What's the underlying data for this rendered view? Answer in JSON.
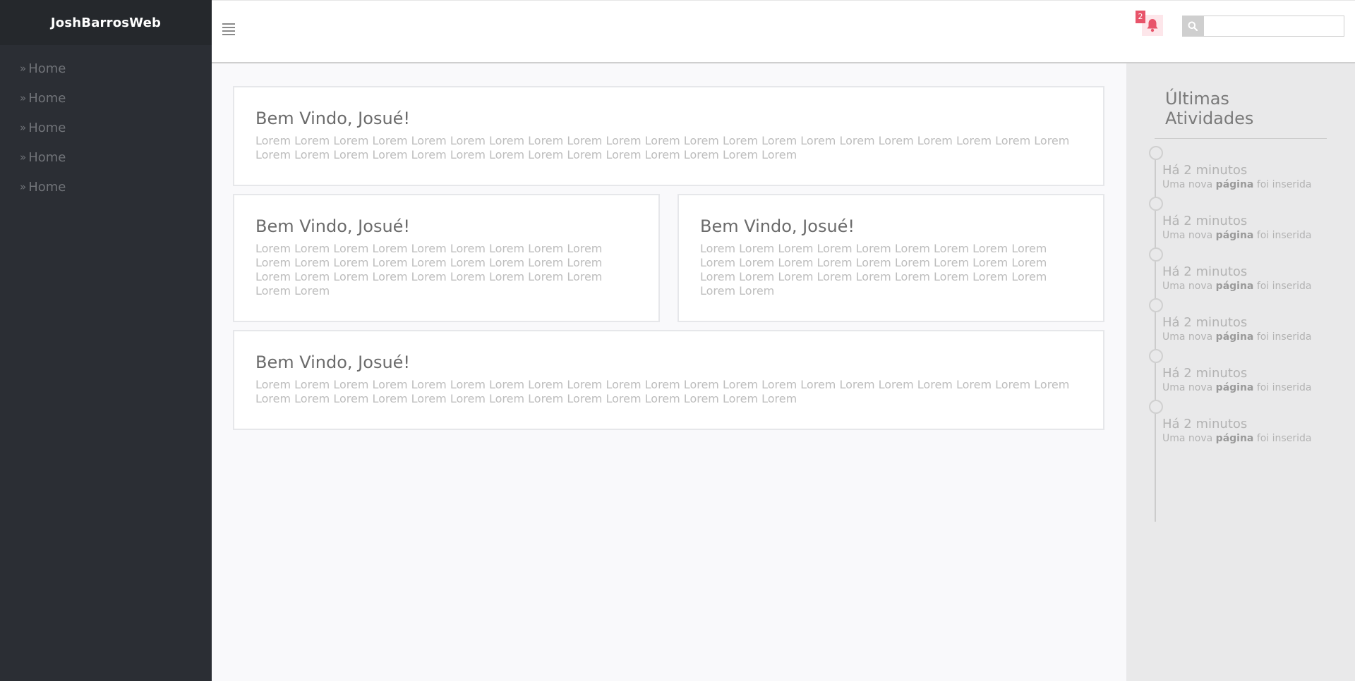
{
  "sidebar": {
    "brand": "JoshBarrosWeb",
    "items": [
      {
        "label": "Home"
      },
      {
        "label": "Home"
      },
      {
        "label": "Home"
      },
      {
        "label": "Home"
      },
      {
        "label": "Home"
      }
    ]
  },
  "header": {
    "notification_count": "2",
    "search": {
      "placeholder": "",
      "value": ""
    },
    "icons": {
      "menu": "hamburger-icon",
      "bell": "bell-icon",
      "search": "search-icon"
    },
    "colors": {
      "badge": "#e8546a",
      "sidebar": "#2b2e34",
      "brand_bar": "#25282c"
    }
  },
  "cards": [
    {
      "title": "Bem Vindo, Josué!",
      "text": "Lorem Lorem Lorem Lorem Lorem Lorem Lorem Lorem Lorem Lorem Lorem Lorem Lorem Lorem Lorem Lorem Lorem Lorem Lorem Lorem Lorem Lorem Lorem Lorem Lorem Lorem Lorem Lorem Lorem Lorem Lorem Lorem Lorem Lorem Lorem"
    },
    {
      "title": "Bem Vindo, Josué!",
      "text": "Lorem Lorem Lorem Lorem Lorem Lorem Lorem Lorem Lorem Lorem Lorem Lorem Lorem Lorem Lorem Lorem Lorem Lorem Lorem Lorem Lorem Lorem Lorem Lorem Lorem Lorem Lorem Lorem Lorem"
    },
    {
      "title": "Bem Vindo, Josué!",
      "text": "Lorem Lorem Lorem Lorem Lorem Lorem Lorem Lorem Lorem Lorem Lorem Lorem Lorem Lorem Lorem Lorem Lorem Lorem Lorem Lorem Lorem Lorem Lorem Lorem Lorem Lorem Lorem Lorem Lorem"
    },
    {
      "title": "Bem Vindo, Josué!",
      "text": "Lorem Lorem Lorem Lorem Lorem Lorem Lorem Lorem Lorem Lorem Lorem Lorem Lorem Lorem Lorem Lorem Lorem Lorem Lorem Lorem Lorem Lorem Lorem Lorem Lorem Lorem Lorem Lorem Lorem Lorem Lorem Lorem Lorem Lorem Lorem"
    }
  ],
  "activity": {
    "title": "Últimas Atividades",
    "items": [
      {
        "time": "Há 2 minutos",
        "desc_pre": "Uma nova",
        "desc_bold": "página",
        "desc_post": "foi inserida"
      },
      {
        "time": "Há 2 minutos",
        "desc_pre": "Uma nova",
        "desc_bold": "página",
        "desc_post": "foi inserida"
      },
      {
        "time": "Há 2 minutos",
        "desc_pre": "Uma nova",
        "desc_bold": "página",
        "desc_post": "foi inserida"
      },
      {
        "time": "Há 2 minutos",
        "desc_pre": "Uma nova",
        "desc_bold": "página",
        "desc_post": "foi inserida"
      },
      {
        "time": "Há 2 minutos",
        "desc_pre": "Uma nova",
        "desc_bold": "página",
        "desc_post": "foi inserida"
      },
      {
        "time": "Há 2 minutos",
        "desc_pre": "Uma nova",
        "desc_bold": "página",
        "desc_post": "foi inserida"
      }
    ]
  }
}
